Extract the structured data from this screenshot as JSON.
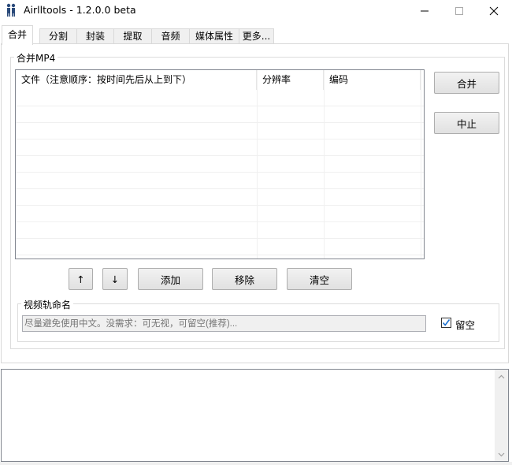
{
  "window": {
    "title": "Airlltools  -  1.2.0.0 beta",
    "minimize_glyph": "—",
    "maximize_glyph": "☐",
    "close_glyph": "✕"
  },
  "tabs": [
    {
      "label": "合并",
      "active": true
    },
    {
      "label": "分割",
      "active": false
    },
    {
      "label": "封装",
      "active": false
    },
    {
      "label": "提取",
      "active": false
    },
    {
      "label": "音频",
      "active": false
    },
    {
      "label": "媒体属性",
      "active": false
    },
    {
      "label": "更多...",
      "active": false
    }
  ],
  "merge": {
    "group_title": "合并MP4",
    "columns": [
      {
        "label": "文件（注意顺序：按时间先后从上到下）"
      },
      {
        "label": "分辨率"
      },
      {
        "label": "编码"
      }
    ],
    "rows": [],
    "merge_button": "合并",
    "stop_button": "中止",
    "move_up_button": "↑",
    "move_down_button": "↓",
    "add_button": "添加",
    "remove_button": "移除",
    "clear_button": "清空"
  },
  "track_name": {
    "group_title": "视频轨命名",
    "placeholder": "尽量避免使用中文。没需求：可无视，可留空(推荐)...",
    "value": "",
    "leave_empty_label": "留空",
    "leave_empty_checked": true
  },
  "log": {
    "text": "",
    "scroll_up_glyph": "⌃",
    "scroll_down_glyph": "⌄"
  },
  "colors": {
    "check_mark": "#1a6fd0",
    "border": "#d9d9d9"
  }
}
